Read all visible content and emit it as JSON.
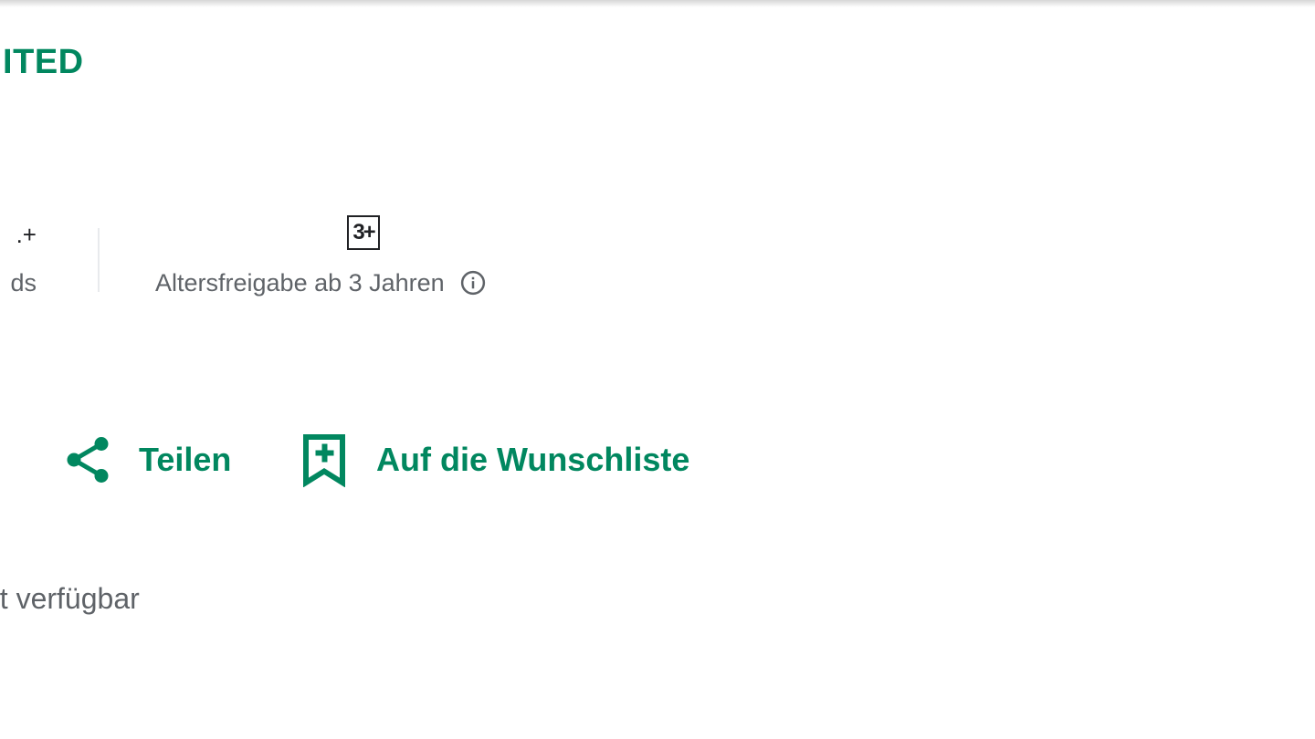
{
  "developer": {
    "name": "IITED"
  },
  "stats": {
    "downloads": {
      "value": ".+",
      "label": "ds"
    },
    "content_rating": {
      "badge": "3+",
      "label": "Altersfreigabe ab 3 Jahren",
      "info_icon": "info-icon"
    }
  },
  "actions": {
    "share": {
      "label": "Teilen",
      "icon": "share-icon"
    },
    "wishlist": {
      "label": "Auf die Wunschliste",
      "icon": "bookmark-add-icon"
    }
  },
  "availability": {
    "text": "ät verfügbar"
  },
  "colors": {
    "accent": "#01875f",
    "text_primary": "#202124",
    "text_secondary": "#5f6368",
    "divider": "#e8eaed"
  }
}
